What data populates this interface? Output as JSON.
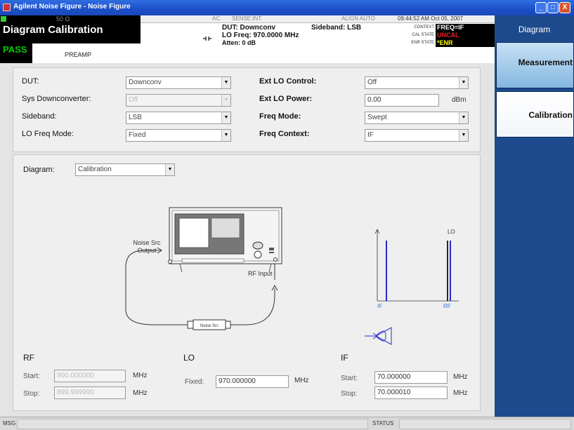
{
  "window": {
    "title": "Agilent Noise Figure - Noise Figure",
    "min": "_",
    "max": "□",
    "close": "X"
  },
  "header": {
    "impedance": "50 Ω",
    "ac": "AC",
    "sense": "SENSE:INT",
    "align": "ALIGN AUTO",
    "timestamp": "09:44:52 AM Oct 05, 2007",
    "mode_title": "Diagram  Calibration",
    "pass": "PASS",
    "preamp": "PREAMP",
    "dut": "DUT: Downconv",
    "sideband": "Sideband: LSB",
    "lo_freq": "LO Freq: 970.0000 MHz",
    "atten": "Atten: 0 dB",
    "context_label": "CONTEXT",
    "context_value": "FREQ=IF",
    "cal_state_label": "CAL STATE",
    "cal_state_value": "UNCAL",
    "enr_state_label": "ENR STATE",
    "enr_state_value": "*ENR"
  },
  "softkeys": {
    "menu_title": "Diagram",
    "items": [
      {
        "label": "Measurement",
        "selected": false
      },
      {
        "label": "Calibration",
        "selected": true
      }
    ]
  },
  "settings": {
    "dut_label": "DUT:",
    "dut_value": "Downconv",
    "sys_downconverter_label": "Sys Downconverter:",
    "sys_downconverter_value": "Off",
    "sideband_label": "Sideband:",
    "sideband_value": "LSB",
    "lo_freq_mode_label": "LO Freq Mode:",
    "lo_freq_mode_value": "Fixed",
    "ext_lo_control_label": "Ext LO Control:",
    "ext_lo_control_value": "Off",
    "ext_lo_power_label": "Ext LO Power:",
    "ext_lo_power_value": "0.00",
    "ext_lo_power_unit": "dBm",
    "freq_mode_label": "Freq Mode:",
    "freq_mode_value": "Swept",
    "freq_context_label": "Freq Context:",
    "freq_context_value": "IF"
  },
  "diagram": {
    "selector_label": "Diagram:",
    "selector_value": "Calibration",
    "noise_src_output_line1": "Noise Src",
    "noise_src_output_line2": "Output",
    "rf_input": "RF Input",
    "noise_src_box": "Noise Src",
    "spectrum_lo": "LO",
    "spectrum_if": "IF",
    "spectrum_rf": "RF",
    "colors": {
      "spectrum_line": "#2a2ad0",
      "if_label": "#3a6ae0"
    },
    "rf": {
      "title": "RF",
      "start_label": "Start:",
      "start_value": "900.000000",
      "stop_label": "Stop:",
      "stop_value": "899.999990",
      "unit": "MHz"
    },
    "lo": {
      "title": "LO",
      "fixed_label": "Fixed:",
      "fixed_value": "970.000000",
      "unit": "MHz"
    },
    "if": {
      "title": "IF",
      "start_label": "Start:",
      "start_value": "70.000000",
      "stop_label": "Stop:",
      "stop_value": "70.000010",
      "unit": "MHz"
    }
  },
  "statusbar": {
    "msg_label": "MSG",
    "status_label": "STATUS"
  }
}
